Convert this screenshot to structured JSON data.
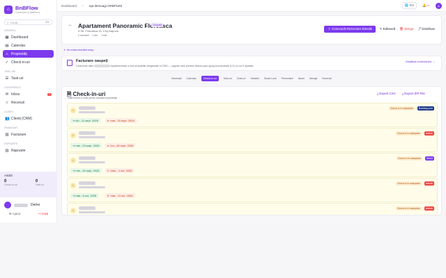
{
  "brand": {
    "name": "BnBFlow",
    "tagline": "Conectare la platforma"
  },
  "search": {
    "placeholder": "Caută...",
    "shortcut": "⌘K"
  },
  "sidebar": {
    "sections": [
      {
        "label": "GENERAL",
        "items": [
          {
            "label": "Dashboard",
            "icon": "grid-icon"
          },
          {
            "label": "Calendar",
            "icon": "calendar-icon"
          },
          {
            "label": "Proprietăți",
            "icon": "home-icon",
            "active": true
          },
          {
            "label": "Check-in-uri",
            "icon": "check-icon"
          }
        ]
      },
      {
        "label": "TASK-URI",
        "items": [
          {
            "label": "Task-uri",
            "icon": "list-icon"
          }
        ]
      },
      {
        "label": "CONVERSAȚII",
        "items": [
          {
            "label": "Inbox",
            "icon": "inbox-icon",
            "badge": "3"
          },
          {
            "label": "Recenzii",
            "icon": "star-icon"
          }
        ]
      },
      {
        "label": "CLIENȚI",
        "items": [
          {
            "label": "Clienți (CRM)",
            "icon": "users-icon"
          }
        ]
      },
      {
        "label": "FINANCIAR",
        "items": [
          {
            "label": "Facturare",
            "icon": "receipt-icon"
          }
        ]
      },
      {
        "label": "RAPOARTE",
        "items": [
          {
            "label": "Rapoarte",
            "icon": "chart-icon"
          }
        ]
      }
    ],
    "activity": {
      "section": "PROFIL",
      "title": "Astăzi",
      "checkin_value": "0",
      "checkin_label": "Check-in-uri",
      "task_value": "0",
      "task_label": "Task-uri"
    },
    "user": {
      "suffix": "Demo"
    },
    "footer": {
      "help": "Ajutor",
      "logout": "Ieșiți"
    }
  },
  "topbar": {
    "crumb1": "Dashboard",
    "crumb2": "Apt demoagi ORBFlo03",
    "lang": "RO",
    "notif": "10+",
    "avatar": "A"
  },
  "property": {
    "title": "Apartament Panoramic Floreasca",
    "status": "Ocupată",
    "address": "Str. Floreasca 15, Cluj-Napoca",
    "meta": [
      "2 membrii",
      "1 dor",
      "1 băi"
    ],
    "actions": {
      "primary": "Conecază Rezervare Directă",
      "edit": "Editează",
      "delete": "Șterge",
      "share": "Distribuie"
    }
  },
  "checklist_note": "Nu exista checklist setup",
  "invoice_box": {
    "title": "Facturare oaspeți",
    "desc": "Conexiune către ▒▒▒▒▒▒▒▒▒ Apartamentului a unei proprietăți înregistrate în CRM — oaspeții care primesc factura apoi ajung la proprietate (LS) nu vor fi ajustate.",
    "action": "Modifică conexiunea →"
  },
  "tabs": [
    "Informații",
    "Calendar",
    "Check-in-uri",
    "Task-uri",
    "Chat-uri",
    "Vizitator",
    "Smart Lock",
    "Prezentare",
    "Istoric",
    "Mesaje",
    "Recenzii"
  ],
  "checkins": {
    "title": "Check-in-uri",
    "subtitle": "Toate check-in-urile pentru această proprietate",
    "export_csv": "Export CSV",
    "export_zip": "Export ZIP File",
    "items": [
      {
        "checkin": "vin., 11 sept. 2026",
        "checkout": "mar., 15 sept. 2026",
        "status": "Check-in în așteptare",
        "platform": "Booking.com",
        "platform_color": "#1e3a8a"
      },
      {
        "checkin": "mie., 23 sept. 2026",
        "checkout": "lun., 28 sept. 2026",
        "status": "Check-in în așteptare",
        "platform": "Airbnb",
        "platform_color": "#ef4444"
      },
      {
        "checkin": "mie., 30 sept. 2026",
        "checkout": "dum., 4 oct. 2026",
        "status": "Check-in în așteptare",
        "platform": "Direct",
        "platform_color": "#7c3aed"
      },
      {
        "checkin": "mar., 6 oct. 2026",
        "checkout": "mar., 13 oct. 2026",
        "status": "Check-in în așteptare",
        "platform": "Airbnb",
        "platform_color": "#ef4444"
      },
      {
        "checkin": "",
        "checkout": "",
        "status": "Check-in în așteptare",
        "platform": "Airbnb",
        "platform_color": "#ef4444"
      }
    ]
  }
}
